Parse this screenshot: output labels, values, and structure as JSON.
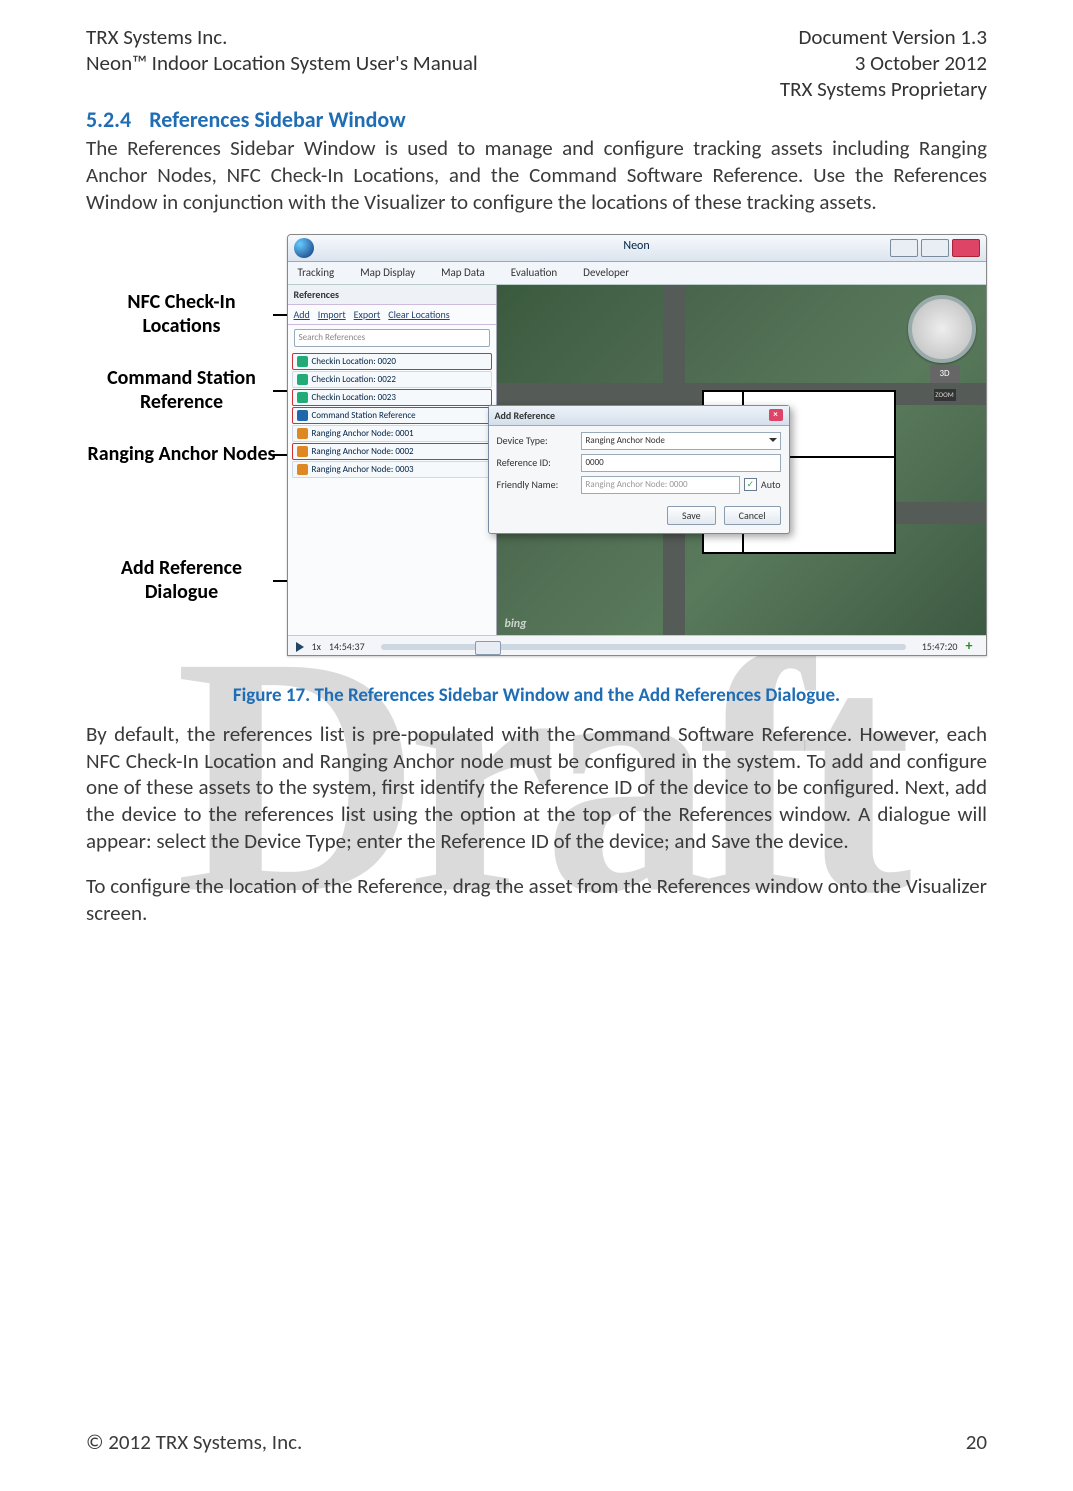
{
  "header": {
    "left1": "TRX Systems Inc.",
    "left2": "Neon™ Indoor Location System User's Manual",
    "right1": "Document Version 1.3",
    "right2": "3 October 2012",
    "right3": "TRX Systems Proprietary"
  },
  "section": {
    "num": "5.2.4",
    "title": "References Sidebar Window"
  },
  "para1": "The References Sidebar Window is used to manage and configure tracking assets including Ranging Anchor Nodes, NFC Check-In Locations, and the Command Software Reference.   Use the References Window in conjunction with the Visualizer to configure the locations of these tracking assets.",
  "callouts": {
    "c1": "NFC Check-In Locations",
    "c2": "Command Station Reference",
    "c3": "Ranging Anchor Nodes",
    "c4": "Add Reference Dialogue"
  },
  "app": {
    "title": "Neon",
    "menu": [
      "Tracking",
      "Map Display",
      "Map Data",
      "Evaluation",
      "Developer"
    ],
    "sidebar": {
      "head": "References",
      "tools": {
        "add": "Add",
        "import": "Import",
        "export": "Export",
        "clear": "Clear Locations"
      },
      "search_placeholder": "Search References",
      "items": [
        {
          "label": "Checkin Location: 0020",
          "hl": true,
          "color": "green"
        },
        {
          "label": "Checkin Location: 0022",
          "hl": false,
          "color": "green"
        },
        {
          "label": "Checkin Location: 0023",
          "hl": true,
          "color": "green"
        },
        {
          "label": "Command Station Reference",
          "hl": true,
          "color": "blue"
        },
        {
          "label": "Ranging Anchor Node: 0001",
          "hl": false,
          "color": "orange"
        },
        {
          "label": "Ranging Anchor Node: 0002",
          "hl": true,
          "color": "orange"
        },
        {
          "label": "Ranging Anchor Node: 0003",
          "hl": false,
          "color": "orange"
        }
      ]
    },
    "dialog": {
      "title": "Add Reference",
      "rows": {
        "devtype_lbl": "Device Type:",
        "devtype_val": "Ranging Anchor Node",
        "refid_lbl": "Reference ID:",
        "refid_val": "0000",
        "fname_lbl": "Friendly Name:",
        "fname_val": "Ranging Anchor Node: 0000",
        "auto": "Auto"
      },
      "buttons": {
        "save": "Save",
        "cancel": "Cancel"
      }
    },
    "map": {
      "threeD": "3D",
      "zoom": "ZOOM",
      "bing": "bing"
    },
    "status": {
      "speed": "1x",
      "t1": "14:54:37",
      "t2": "15:47:20"
    }
  },
  "caption": "Figure 17.  The References Sidebar Window and the Add References Dialogue.",
  "para2": "By default, the references list is pre-populated with the Command Software Reference.  However, each NFC Check-In Location and Ranging Anchor node must be configured in the system.   To add and configure one of these assets to the system, first identify the Reference ID of the device to be configured.   Next, add the device to the references list using the option at the top of the References window.  A dialogue will appear:  select the Device Type; enter the Reference ID of the device; and Save the device.",
  "para3": "To configure the location of the Reference, drag the asset from the References window onto the Visualizer screen.",
  "watermark": "Draft",
  "footer": {
    "left": "© 2012 TRX Systems, Inc.",
    "right": "20"
  }
}
